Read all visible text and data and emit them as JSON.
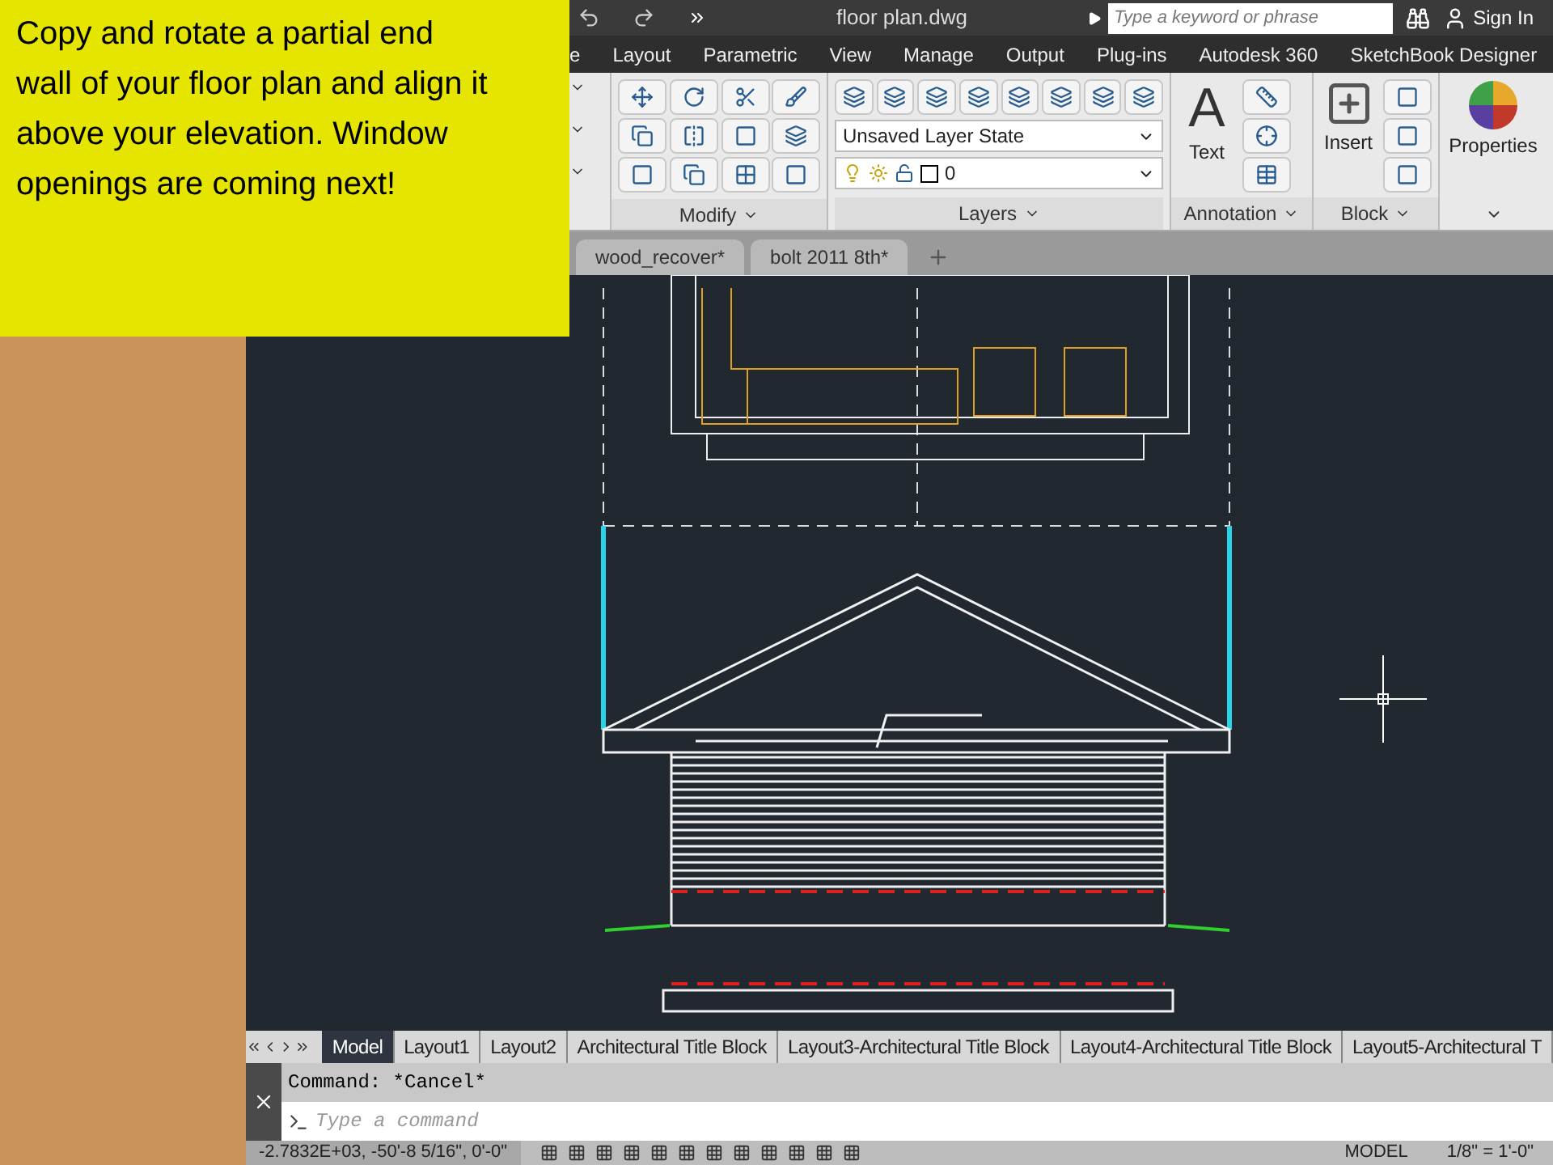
{
  "caption": "Copy and rotate a partial end wall of your floor plan and align it above your elevation. Window openings are coming next!",
  "window": {
    "title": "floor plan.dwg",
    "search_placeholder": "Type a keyword or phrase",
    "sign_in": "Sign In"
  },
  "menu_tabs": [
    "e",
    "Layout",
    "Parametric",
    "View",
    "Manage",
    "Output",
    "Plug-ins",
    "Autodesk 360",
    "SketchBook Designer"
  ],
  "ribbon": {
    "panels": [
      "Modify",
      "Layers",
      "Annotation",
      "Block"
    ],
    "layer_state": "Unsaved Layer State",
    "layer": "0",
    "text_glyph": "A",
    "text_tool": "Text",
    "insert_tool": "Insert",
    "properties_tool": "Properties"
  },
  "file_tabs": [
    "wood_recover*",
    "bolt 2011 8th*"
  ],
  "layout_tabs": [
    {
      "label": "Model",
      "selected": true
    },
    {
      "label": "Layout1",
      "selected": false
    },
    {
      "label": "Layout2",
      "selected": false
    },
    {
      "label": "Architectural Title Block",
      "selected": false
    },
    {
      "label": "Layout3-Architectural Title Block",
      "selected": false
    },
    {
      "label": "Layout4-Architectural Title Block",
      "selected": false
    },
    {
      "label": "Layout5-Architectural T",
      "selected": false
    }
  ],
  "command": {
    "history": "Command: *Cancel*",
    "placeholder": "Type a command"
  },
  "status_bar": {
    "coordinates": "-2.7832E+03, -50'-8 5/16\", 0'-0\"",
    "space": "MODEL",
    "scale": "1/8\" = 1'-0\""
  }
}
